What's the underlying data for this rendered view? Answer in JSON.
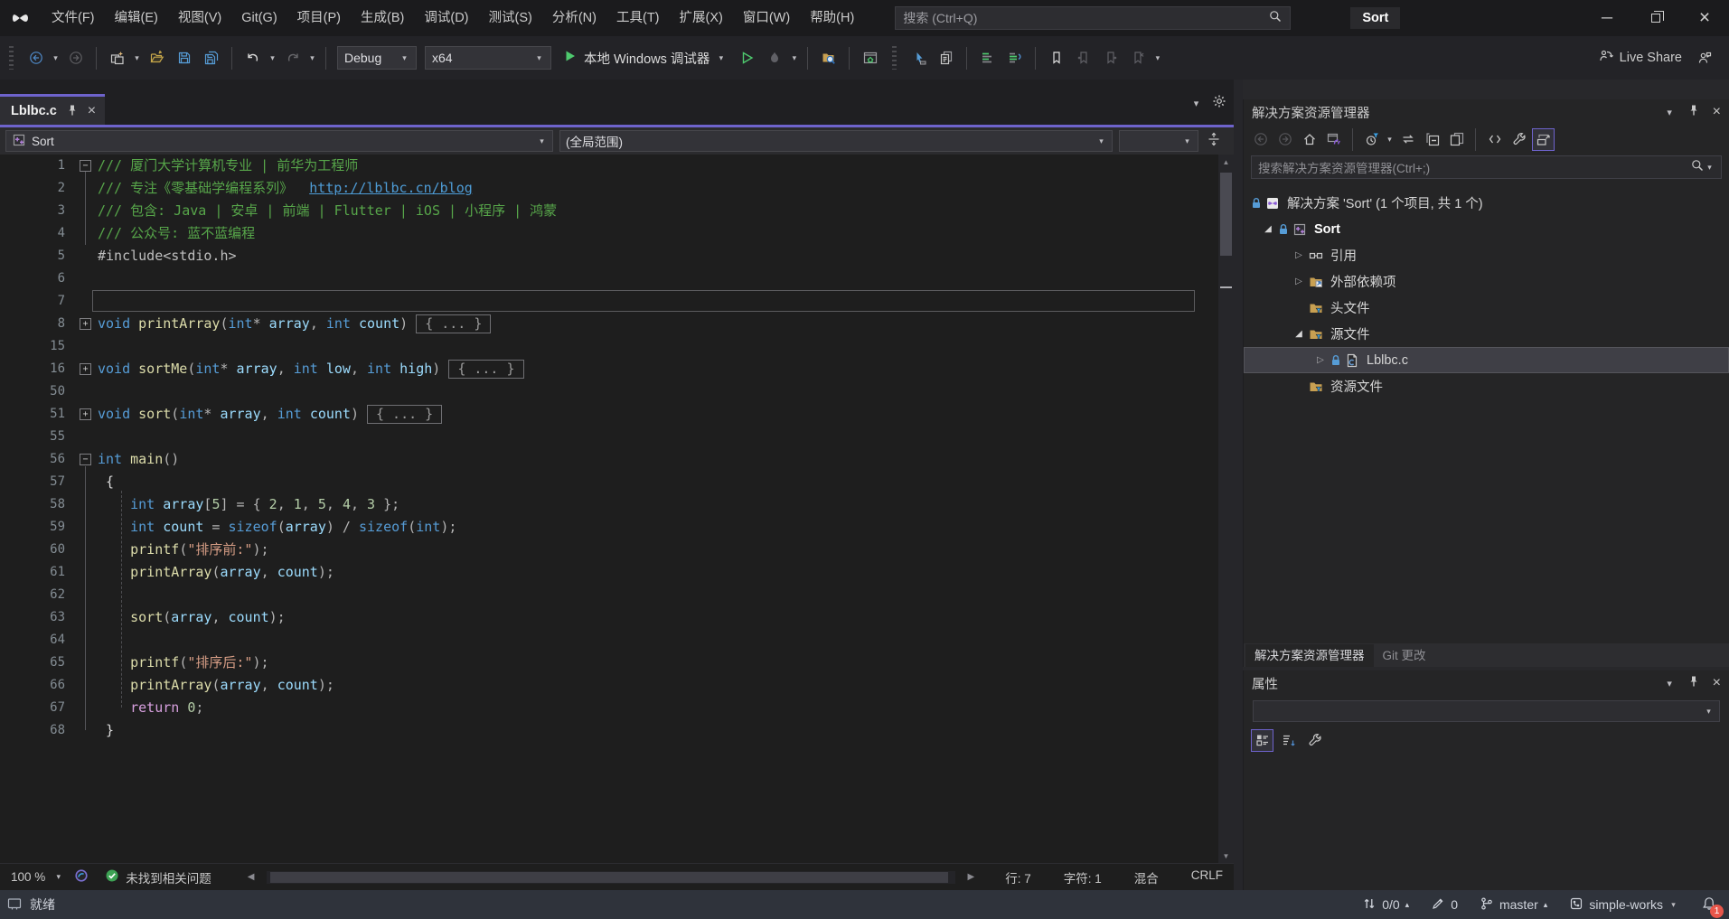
{
  "colors": {
    "accent": "#6E63CC",
    "run_green": "#4EC96E",
    "check_green": "#3DA254",
    "badge_red": "#E8564A",
    "comment_green": "#57A64A",
    "keyword_blue": "#569CD6",
    "string_orange": "#D69D85",
    "number_green": "#B5CEA8",
    "function_yellow": "#DCDCAA",
    "control_purple": "#D8A0DF",
    "folder_gold": "#C8A052"
  },
  "icons": {
    "chevron_down": "▾",
    "left": "◀",
    "right": "▶",
    "up": "▲",
    "down": "▼",
    "minimize": "─",
    "close": "×",
    "exp_open": "◢",
    "exp_closed": "▷",
    "caret_up": "▴"
  },
  "titlebar": {
    "menus": [
      "文件(F)",
      "编辑(E)",
      "视图(V)",
      "Git(G)",
      "项目(P)",
      "生成(B)",
      "调试(D)",
      "测试(S)",
      "分析(N)",
      "工具(T)",
      "扩展(X)",
      "窗口(W)",
      "帮助(H)"
    ],
    "search_placeholder": "搜索 (Ctrl+Q)",
    "window_title": "Sort"
  },
  "toolbar": {
    "debug_config": "Debug",
    "platform": "x64",
    "run_label": "本地 Windows 调试器",
    "live_share_label": "Live Share"
  },
  "editor": {
    "tab_label": "Lblbc.c",
    "nav": {
      "member": "Sort",
      "scope": "(全局范围)"
    },
    "fold_placeholder": "{ ... }",
    "status": {
      "zoom": "100 %",
      "health": "未找到相关问题",
      "line": "行: 7",
      "col": "字符: 1",
      "mixed": "混合",
      "eol": "CRLF"
    },
    "lines": [
      {
        "n": 1,
        "fold": "−",
        "segs": [
          [
            "cm",
            "/// 厦门大学计算机专业 | 前华为工程师"
          ]
        ]
      },
      {
        "n": 2,
        "segs": [
          [
            "cm",
            "/// 专注《零基础学编程系列》  "
          ],
          [
            "url",
            "http://lblbc.cn/blog"
          ]
        ]
      },
      {
        "n": 3,
        "segs": [
          [
            "cm",
            "/// 包含: Java | 安卓 | 前端 | Flutter | iOS | 小程序 | 鸿蒙"
          ]
        ]
      },
      {
        "n": 4,
        "segs": [
          [
            "cm",
            "/// 公众号: 蓝不蓝编程"
          ]
        ]
      },
      {
        "n": 5,
        "segs": [
          [
            "pp",
            "#include<stdio.h>"
          ]
        ]
      },
      {
        "n": 6,
        "segs": []
      },
      {
        "n": 7,
        "segs": [],
        "current": true
      },
      {
        "n": 8,
        "fold": "+",
        "segs": [
          [
            "kw",
            "void"
          ],
          [
            "pl",
            " "
          ],
          [
            "fn",
            "printArray"
          ],
          [
            "op",
            "("
          ],
          [
            "kw",
            "int"
          ],
          [
            "op",
            "* "
          ],
          [
            "var",
            "array"
          ],
          [
            "op",
            ", "
          ],
          [
            "kw",
            "int"
          ],
          [
            "pl",
            " "
          ],
          [
            "var",
            "count"
          ],
          [
            "op",
            ")"
          ]
        ],
        "box": true
      },
      {
        "n": 15,
        "segs": []
      },
      {
        "n": 16,
        "fold": "+",
        "segs": [
          [
            "kw",
            "void"
          ],
          [
            "pl",
            " "
          ],
          [
            "fn",
            "sortMe"
          ],
          [
            "op",
            "("
          ],
          [
            "kw",
            "int"
          ],
          [
            "op",
            "* "
          ],
          [
            "var",
            "array"
          ],
          [
            "op",
            ", "
          ],
          [
            "kw",
            "int"
          ],
          [
            "pl",
            " "
          ],
          [
            "var",
            "low"
          ],
          [
            "op",
            ", "
          ],
          [
            "kw",
            "int"
          ],
          [
            "pl",
            " "
          ],
          [
            "var",
            "high"
          ],
          [
            "op",
            ")"
          ]
        ],
        "box": true
      },
      {
        "n": 50,
        "segs": []
      },
      {
        "n": 51,
        "fold": "+",
        "segs": [
          [
            "kw",
            "void"
          ],
          [
            "pl",
            " "
          ],
          [
            "fn",
            "sort"
          ],
          [
            "op",
            "("
          ],
          [
            "kw",
            "int"
          ],
          [
            "op",
            "* "
          ],
          [
            "var",
            "array"
          ],
          [
            "op",
            ", "
          ],
          [
            "kw",
            "int"
          ],
          [
            "pl",
            " "
          ],
          [
            "var",
            "count"
          ],
          [
            "op",
            ")"
          ]
        ],
        "box": true
      },
      {
        "n": 55,
        "segs": []
      },
      {
        "n": 56,
        "fold": "−",
        "segs": [
          [
            "kw",
            "int"
          ],
          [
            "pl",
            " "
          ],
          [
            "fn",
            "main"
          ],
          [
            "op",
            "()"
          ]
        ]
      },
      {
        "n": 57,
        "segs": [
          [
            "pl",
            " {"
          ]
        ]
      },
      {
        "n": 58,
        "segs": [
          [
            "pl",
            "    "
          ],
          [
            "kw",
            "int"
          ],
          [
            "pl",
            " "
          ],
          [
            "var",
            "array"
          ],
          [
            "op",
            "["
          ],
          [
            "num",
            "5"
          ],
          [
            "op",
            "] = { "
          ],
          [
            "num",
            "2"
          ],
          [
            "op",
            ", "
          ],
          [
            "num",
            "1"
          ],
          [
            "op",
            ", "
          ],
          [
            "num",
            "5"
          ],
          [
            "op",
            ", "
          ],
          [
            "num",
            "4"
          ],
          [
            "op",
            ", "
          ],
          [
            "num",
            "3"
          ],
          [
            "op",
            " };"
          ]
        ]
      },
      {
        "n": 59,
        "segs": [
          [
            "pl",
            "    "
          ],
          [
            "kw",
            "int"
          ],
          [
            "pl",
            " "
          ],
          [
            "var",
            "count"
          ],
          [
            "op",
            " = "
          ],
          [
            "kw",
            "sizeof"
          ],
          [
            "op",
            "("
          ],
          [
            "var",
            "array"
          ],
          [
            "op",
            ") / "
          ],
          [
            "kw",
            "sizeof"
          ],
          [
            "op",
            "("
          ],
          [
            "kw",
            "int"
          ],
          [
            "op",
            ");"
          ]
        ]
      },
      {
        "n": 60,
        "segs": [
          [
            "pl",
            "    "
          ],
          [
            "fn",
            "printf"
          ],
          [
            "op",
            "("
          ],
          [
            "str",
            "\"排序前:\""
          ],
          [
            "op",
            ");"
          ]
        ]
      },
      {
        "n": 61,
        "segs": [
          [
            "pl",
            "    "
          ],
          [
            "fn",
            "printArray"
          ],
          [
            "op",
            "("
          ],
          [
            "var",
            "array"
          ],
          [
            "op",
            ", "
          ],
          [
            "var",
            "count"
          ],
          [
            "op",
            ");"
          ]
        ]
      },
      {
        "n": 62,
        "segs": []
      },
      {
        "n": 63,
        "segs": [
          [
            "pl",
            "    "
          ],
          [
            "fn",
            "sort"
          ],
          [
            "op",
            "("
          ],
          [
            "var",
            "array"
          ],
          [
            "op",
            ", "
          ],
          [
            "var",
            "count"
          ],
          [
            "op",
            ");"
          ]
        ]
      },
      {
        "n": 64,
        "segs": []
      },
      {
        "n": 65,
        "segs": [
          [
            "pl",
            "    "
          ],
          [
            "fn",
            "printf"
          ],
          [
            "op",
            "("
          ],
          [
            "str",
            "\"排序后:\""
          ],
          [
            "op",
            ");"
          ]
        ]
      },
      {
        "n": 66,
        "segs": [
          [
            "pl",
            "    "
          ],
          [
            "fn",
            "printArray"
          ],
          [
            "op",
            "("
          ],
          [
            "var",
            "array"
          ],
          [
            "op",
            ", "
          ],
          [
            "var",
            "count"
          ],
          [
            "op",
            ");"
          ]
        ]
      },
      {
        "n": 67,
        "segs": [
          [
            "pl",
            "    "
          ],
          [
            "kwc",
            "return"
          ],
          [
            "pl",
            " "
          ],
          [
            "num",
            "0"
          ],
          [
            "op",
            ";"
          ]
        ]
      },
      {
        "n": 68,
        "segs": [
          [
            "pl",
            " }"
          ]
        ]
      }
    ]
  },
  "solution_explorer": {
    "title": "解决方案资源管理器",
    "search_placeholder": "搜索解决方案资源管理器(Ctrl+;)",
    "items": [
      {
        "label": "解决方案 'Sort' (1 个项目, 共 1 个)",
        "icon": "solution",
        "lock": true,
        "pad": 6,
        "noexp": true
      },
      {
        "label": "Sort",
        "icon": "project",
        "lock": true,
        "exp": "open",
        "pad": 18,
        "bold": true
      },
      {
        "label": "引用",
        "icon": "references",
        "exp": "closed",
        "pad": 52
      },
      {
        "label": "外部依赖项",
        "icon": "extdeps",
        "exp": "closed",
        "pad": 52
      },
      {
        "label": "头文件",
        "icon": "folderfilter",
        "pad": 52
      },
      {
        "label": "源文件",
        "icon": "folderfilter",
        "exp": "open",
        "pad": 52
      },
      {
        "label": "Lblbc.c",
        "icon": "cfile",
        "lock": true,
        "exp": "closed",
        "pad": 76,
        "selected": true
      },
      {
        "label": "资源文件",
        "icon": "folderfilter",
        "pad": 52
      }
    ],
    "tabs": [
      "解决方案资源管理器",
      "Git 更改"
    ]
  },
  "properties": {
    "title": "属性"
  },
  "statusbar": {
    "ready": "就绪",
    "sync_counts": "0/0",
    "pending_edits": "0",
    "branch": "master",
    "repo": "simple-works",
    "notifications_badge": "1"
  }
}
